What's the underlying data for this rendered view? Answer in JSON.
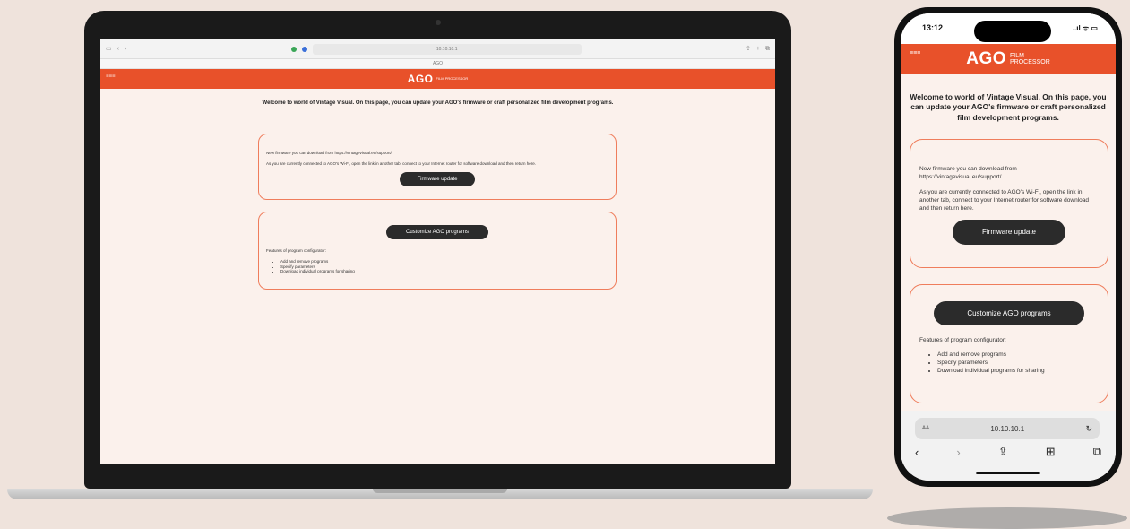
{
  "laptop": {
    "browser": {
      "address": "10.10.10.1",
      "tab_label": "AGO",
      "left_icons": [
        "sidebar-icon",
        "back-icon",
        "forward-icon"
      ],
      "right_icons": [
        "share-icon",
        "add-tab-icon",
        "tabs-icon"
      ]
    },
    "app": {
      "menu_icon": "≡≡≡",
      "logo": "AGO",
      "logo_sub": "FILM PROCESSOR",
      "welcome": "Welcome to world of Vintage Visual. On this page, you can update your AGO's firmware or craft personalized film development programs.",
      "firmware_card": {
        "download_text": "New firmware you can download from https://vintagevisual.eu/support/",
        "connected_text": "As you are currently connected to AGO's Wi-Fi, open the link in another tab, connect to your Internet router for software download and then return here.",
        "button": "Firmware update"
      },
      "program_card": {
        "button": "Customize AGO programs",
        "features_label": "Features of program configurator:",
        "features": [
          "Add and remove programs",
          "Specify parameters",
          "Download individual programs for sharing"
        ]
      }
    }
  },
  "phone": {
    "status": {
      "time": "13:12",
      "indicators": "..ıl ᯤ ▭"
    },
    "app": {
      "menu_icon": "≡≡≡",
      "logo": "AGO",
      "logo_sub_line1": "FILM",
      "logo_sub_line2": "PROCESSOR",
      "welcome": "Welcome to world of Vintage Visual. On this page, you can update your AGO's firmware or craft personalized film development programs.",
      "firmware_card": {
        "download_text": "New firmware you can download from https://vintagevisual.eu/support/",
        "connected_text": "As you are currently connected to AGO's Wi-Fi, open the link in another tab, connect to your Internet router for software download and then return here.",
        "button": "Firmware update"
      },
      "program_card": {
        "button": "Customize AGO programs",
        "features_label": "Features of program configurator:",
        "features": [
          "Add and remove programs",
          "Specify parameters",
          "Download individual programs for sharing"
        ]
      }
    },
    "safari": {
      "aa_label": "AA",
      "url": "10.10.10.1",
      "reload_icon": "↻",
      "nav": {
        "back": "‹",
        "forward": "›",
        "share": "⇪",
        "bookmarks": "⊞",
        "tabs": "⧉"
      }
    }
  }
}
